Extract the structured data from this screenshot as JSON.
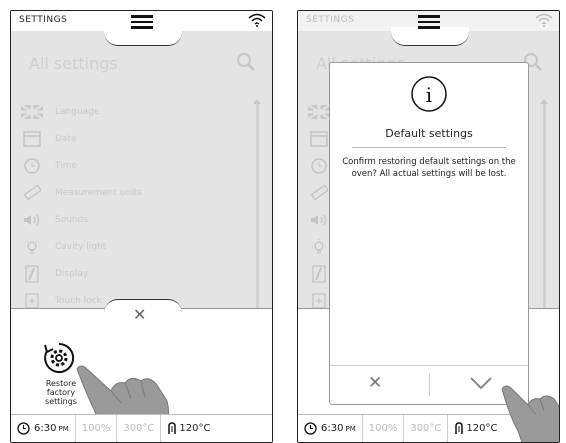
{
  "screen1": {
    "title": "SETTINGS",
    "heading": "All settings",
    "items": [
      {
        "label": "Language",
        "icon": "flag-icon"
      },
      {
        "label": "Date",
        "icon": "calendar-icon"
      },
      {
        "label": "Time",
        "icon": "clock-icon"
      },
      {
        "label": "Measurement units",
        "icon": "ruler-icon"
      },
      {
        "label": "Sounds",
        "icon": "speaker-icon"
      },
      {
        "label": "Cavity light",
        "icon": "bulb-icon"
      },
      {
        "label": "Display",
        "icon": "display-icon"
      },
      {
        "label": "Touch lock",
        "icon": "lock-icon"
      }
    ],
    "close_symbol": "✕",
    "restore_label": "Restore factory settings"
  },
  "screen2": {
    "title": "SETTINGS",
    "heading": "All settings",
    "dialog": {
      "info_symbol": "i",
      "title": "Default settings",
      "text": "Confirm restoring default settings on the oven? All actual settings will be lost.",
      "cancel_symbol": "✕"
    }
  },
  "status": {
    "time": "6:30",
    "ampm": "PM",
    "power": "100%",
    "temp": "300°C",
    "probe": "120°C"
  }
}
